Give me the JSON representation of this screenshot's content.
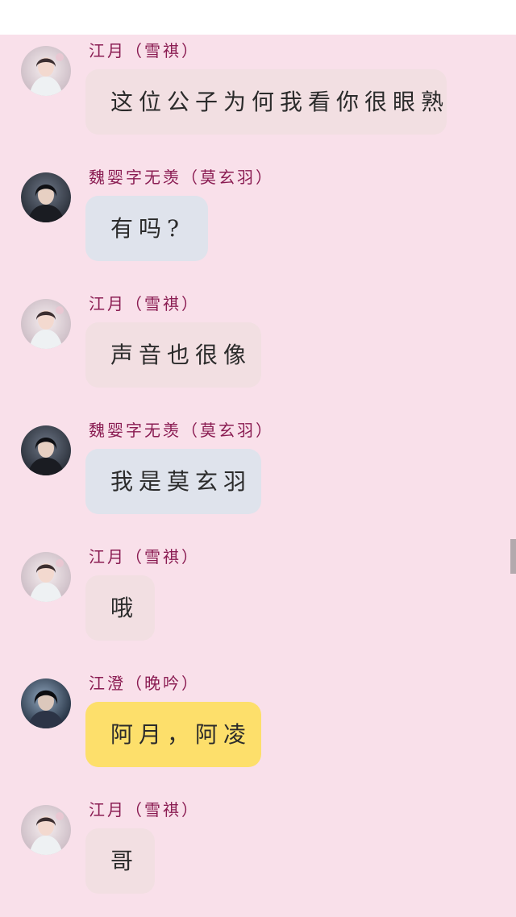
{
  "messages": [
    {
      "sender": "江月（雪祺）",
      "avatar": "avatar-xueqi-icon",
      "bubble_color": "#f2dfe2",
      "text": "这位公子为何我看你很眼熟"
    },
    {
      "sender": "魏婴字无羡（莫玄羽）",
      "avatar": "avatar-weiying-icon",
      "bubble_color": "#dfe3ec",
      "text": "有吗?"
    },
    {
      "sender": "江月（雪祺）",
      "avatar": "avatar-xueqi-icon",
      "bubble_color": "#f2dfe2",
      "text": "声音也很像"
    },
    {
      "sender": "魏婴字无羡（莫玄羽）",
      "avatar": "avatar-weiying-icon",
      "bubble_color": "#dfe3ec",
      "text": "我是莫玄羽"
    },
    {
      "sender": "江月（雪祺）",
      "avatar": "avatar-xueqi-icon",
      "bubble_color": "#f2dfe2",
      "text": "哦"
    },
    {
      "sender": "江澄（晚吟）",
      "avatar": "avatar-jiangcheng-icon",
      "bubble_color": "#fddf6b",
      "text": "阿月，阿凌"
    },
    {
      "sender": "江月（雪祺）",
      "avatar": "avatar-xueqi-icon",
      "bubble_color": "#f2dfe2",
      "text": "哥"
    }
  ],
  "colors": {
    "background": "#f9e0ea",
    "sender_name": "#8a1c52"
  }
}
